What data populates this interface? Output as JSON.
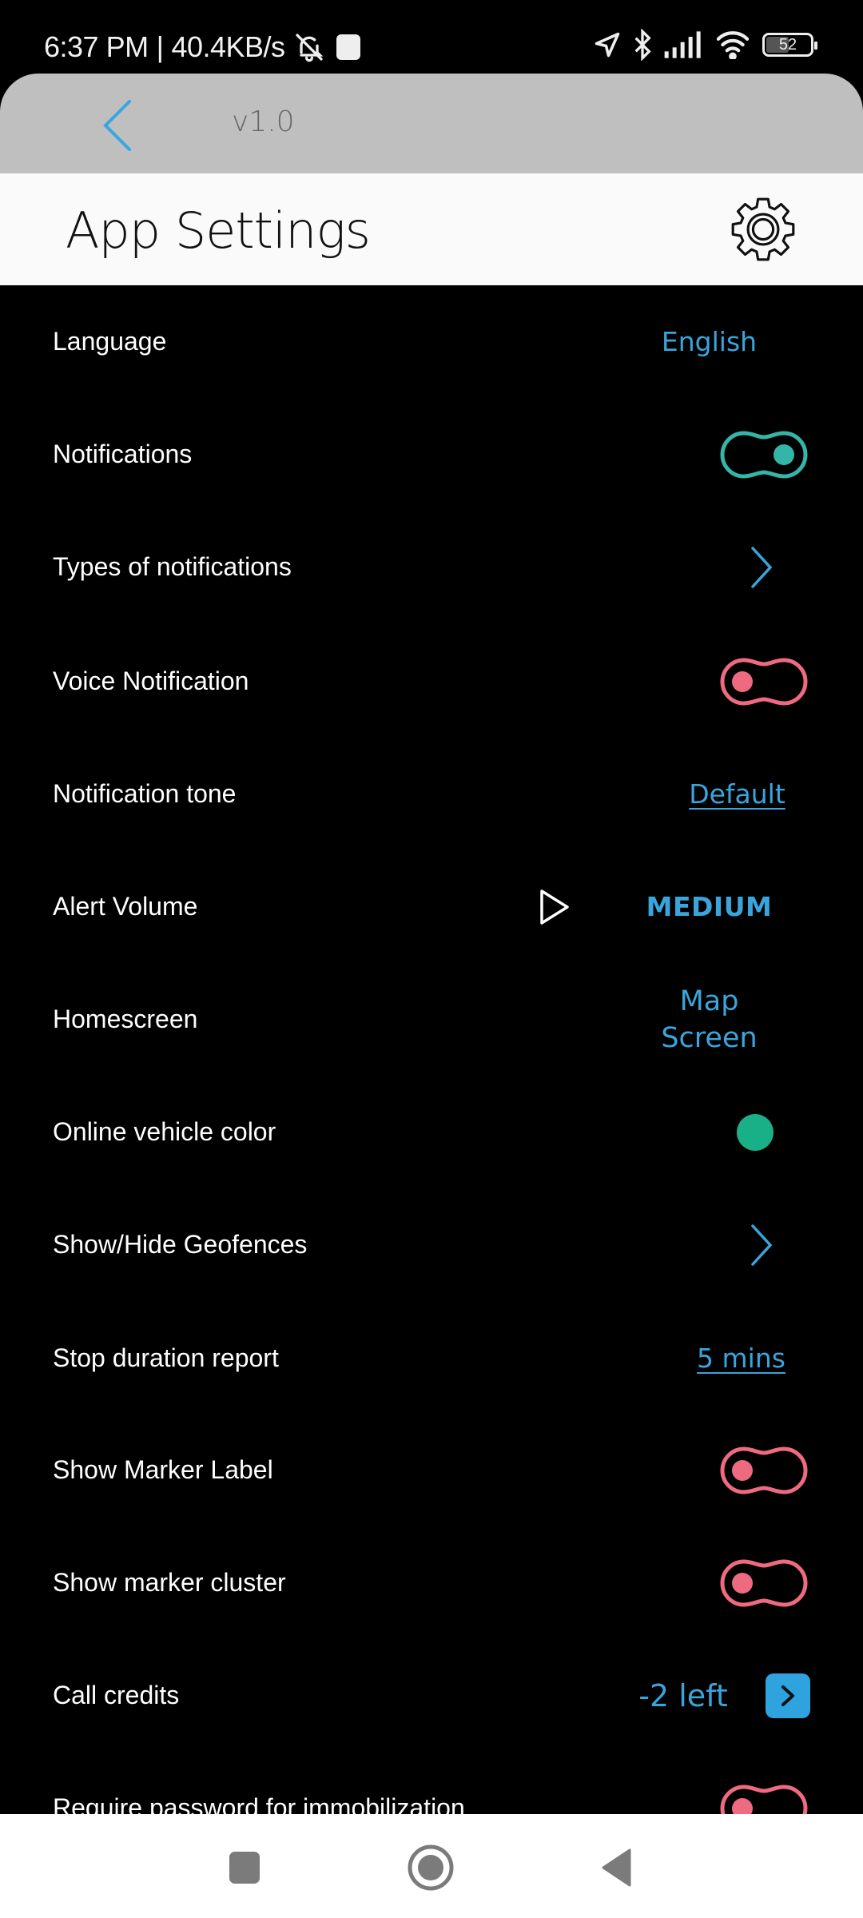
{
  "status_bar": {
    "time": "6:37 PM",
    "separator": "|",
    "network_speed": "40.4KB/s",
    "battery_level": "52",
    "icons": [
      "bell-off-icon",
      "notification-square-icon",
      "location-arrow-icon",
      "bluetooth-icon",
      "signal-icon",
      "wifi-icon",
      "battery-icon"
    ]
  },
  "header": {
    "back_icon": "chevron-left-icon",
    "version": "v1.0",
    "title": "App Settings",
    "settings_icon": "gear-icon"
  },
  "colors": {
    "accent_blue": "#3aa5dc",
    "toggle_on": "#35b5a8",
    "toggle_off": "#ee6a80",
    "online_vehicle": "#1ab087",
    "call_credits_button": "#2ea3de"
  },
  "settings": [
    {
      "label": "Language",
      "type": "value",
      "value": "English"
    },
    {
      "label": "Notifications",
      "type": "toggle",
      "on": true
    },
    {
      "label": "Types of notifications",
      "type": "chevron"
    },
    {
      "label": "Voice Notification",
      "type": "toggle",
      "on": false
    },
    {
      "label": "Notification tone",
      "type": "link",
      "value": "Default"
    },
    {
      "label": "Alert Volume",
      "type": "volume",
      "value": "MEDIUM",
      "play_icon": "play-icon"
    },
    {
      "label": "Homescreen",
      "type": "value",
      "value_lines": [
        "Map",
        "Screen"
      ]
    },
    {
      "label": "Online vehicle color",
      "type": "color",
      "color": "#1ab087"
    },
    {
      "label": "Show/Hide Geofences",
      "type": "chevron"
    },
    {
      "label": "Stop duration report",
      "type": "link",
      "value": "5 mins"
    },
    {
      "label": "Show Marker Label",
      "type": "toggle",
      "on": false
    },
    {
      "label": "Show marker cluster",
      "type": "toggle",
      "on": false
    },
    {
      "label": "Call credits",
      "type": "credits",
      "value": "-2 left"
    },
    {
      "label": "Require password for immobilization",
      "type": "toggle",
      "on": false
    }
  ],
  "nav_bar": {
    "recents": "recents-square-icon",
    "home": "home-circle-icon",
    "back": "back-triangle-icon"
  }
}
